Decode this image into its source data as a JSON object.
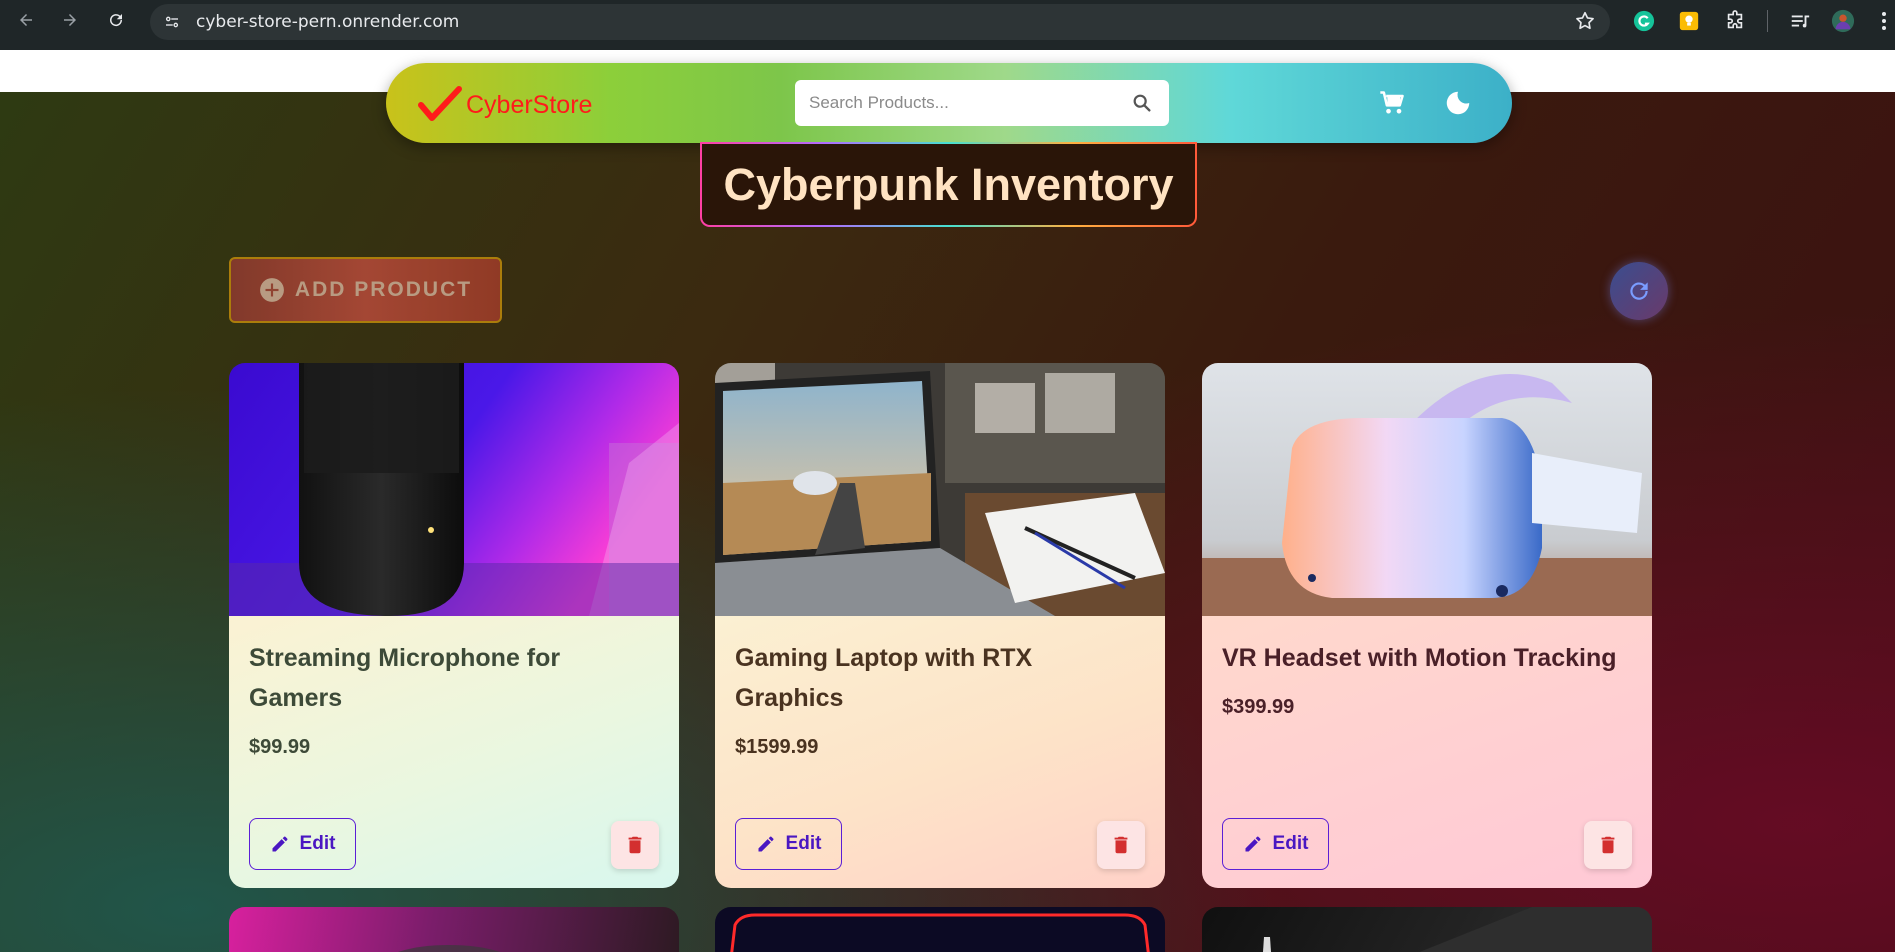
{
  "browser": {
    "url": "cyber-store-pern.onrender.com"
  },
  "navbar": {
    "brand": "CyberStore",
    "search_placeholder": "Search Products..."
  },
  "page": {
    "title": "Cyberpunk Inventory",
    "add_button": "ADD PRODUCT"
  },
  "products": [
    {
      "name": "Streaming Microphone for Gamers",
      "price": "$99.99",
      "edit_label": "Edit"
    },
    {
      "name": "Gaming Laptop with RTX Graphics",
      "price": "$1599.99",
      "edit_label": "Edit"
    },
    {
      "name": "VR Headset with Motion Tracking",
      "price": "$399.99",
      "edit_label": "Edit"
    }
  ],
  "colors": {
    "brand_red": "#ff1b1b",
    "edit_purple": "#4a17c2",
    "delete_red": "#d32f2f"
  }
}
